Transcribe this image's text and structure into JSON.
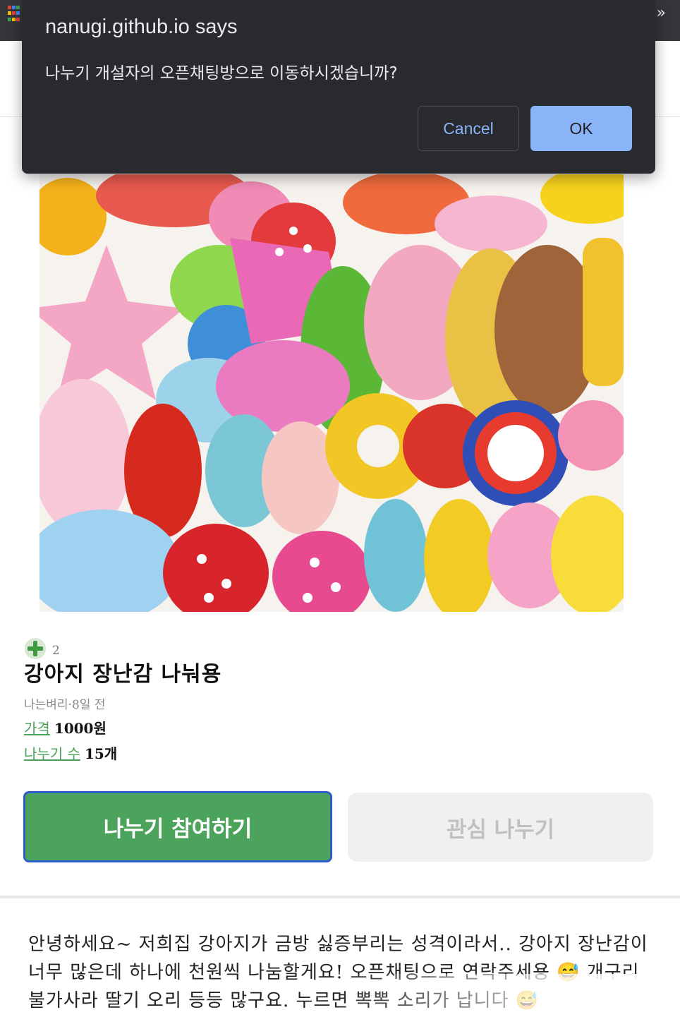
{
  "dialog": {
    "title": "nanugi.github.io says",
    "message": "나누기 개설자의 오픈채팅방으로 이동하시겠습니까?",
    "cancel_label": "Cancel",
    "ok_label": "OK"
  },
  "chrome": {
    "overflow_glyph": "»"
  },
  "product": {
    "image_icon": "dog-toys-photo",
    "like_count": "2",
    "title": "강아지 장난감 나눠용",
    "author_time": "나는벼리·8일 전",
    "price_label": "가격",
    "price_value": "1000원",
    "count_label": "나누기 수",
    "count_value": "15개"
  },
  "actions": {
    "join_label": "나누기 참여하기",
    "like_label": "관심 나누기"
  },
  "description": {
    "text": "안녕하세요~ 저희집 강아지가 금방 싫증부리는 성격이라서.. 강아지 장난감이 너무 많은데 하나에 천원씩 나눔할게요! 오픈채팅으로 연락주세용 😅 개구리 불가사라 딸기 오리 등등 많구요. 누르면 뽁뽁 소리가 납니다 😅"
  },
  "colors": {
    "accent_green": "#4ca45c",
    "dialog_bg": "#292a2d",
    "dialog_button_blue": "#8ab4f8",
    "focus_outline": "#2b5fc8"
  }
}
